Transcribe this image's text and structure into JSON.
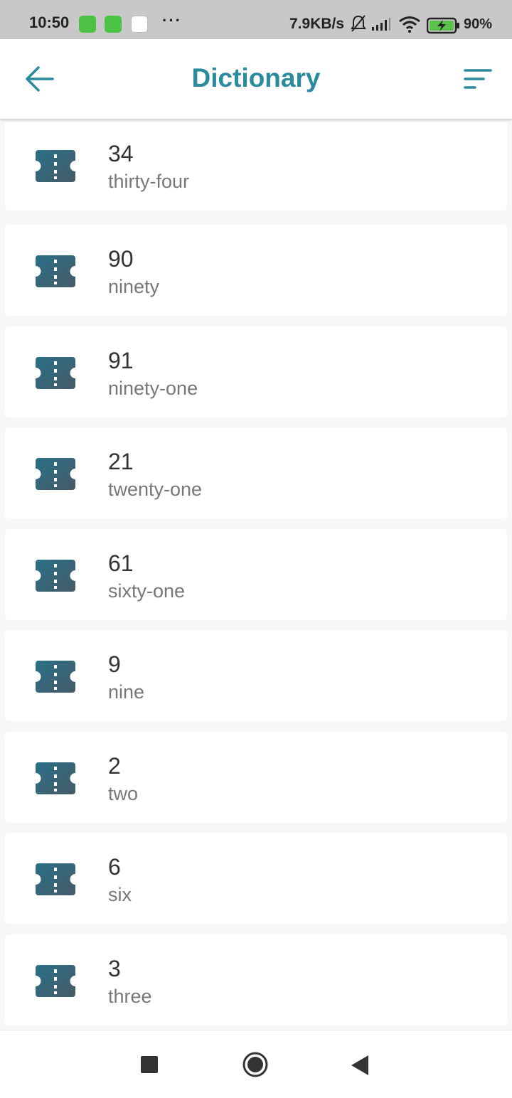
{
  "status_bar": {
    "time": "10:50",
    "notification_icons": [
      "android-app-icon",
      "android-app-icon",
      "calendar-icon"
    ],
    "more": "···",
    "network_speed": "7.9KB/s",
    "battery": "90%"
  },
  "app_bar": {
    "title": "Dictionary",
    "back_icon": "arrow-left-icon",
    "sort_icon": "sort-icon",
    "accent_color": "#2a8a9e"
  },
  "entries": [
    {
      "number": "34",
      "word": "thirty-four"
    },
    {
      "number": "90",
      "word": "ninety"
    },
    {
      "number": "91",
      "word": "ninety-one"
    },
    {
      "number": "21",
      "word": "twenty-one"
    },
    {
      "number": "61",
      "word": "sixty-one"
    },
    {
      "number": "9",
      "word": "nine"
    },
    {
      "number": "2",
      "word": "two"
    },
    {
      "number": "6",
      "word": "six"
    },
    {
      "number": "3",
      "word": "three"
    }
  ],
  "nav_bar": {
    "buttons": [
      "recents-square-icon",
      "home-circle-icon",
      "back-triangle-icon"
    ]
  }
}
